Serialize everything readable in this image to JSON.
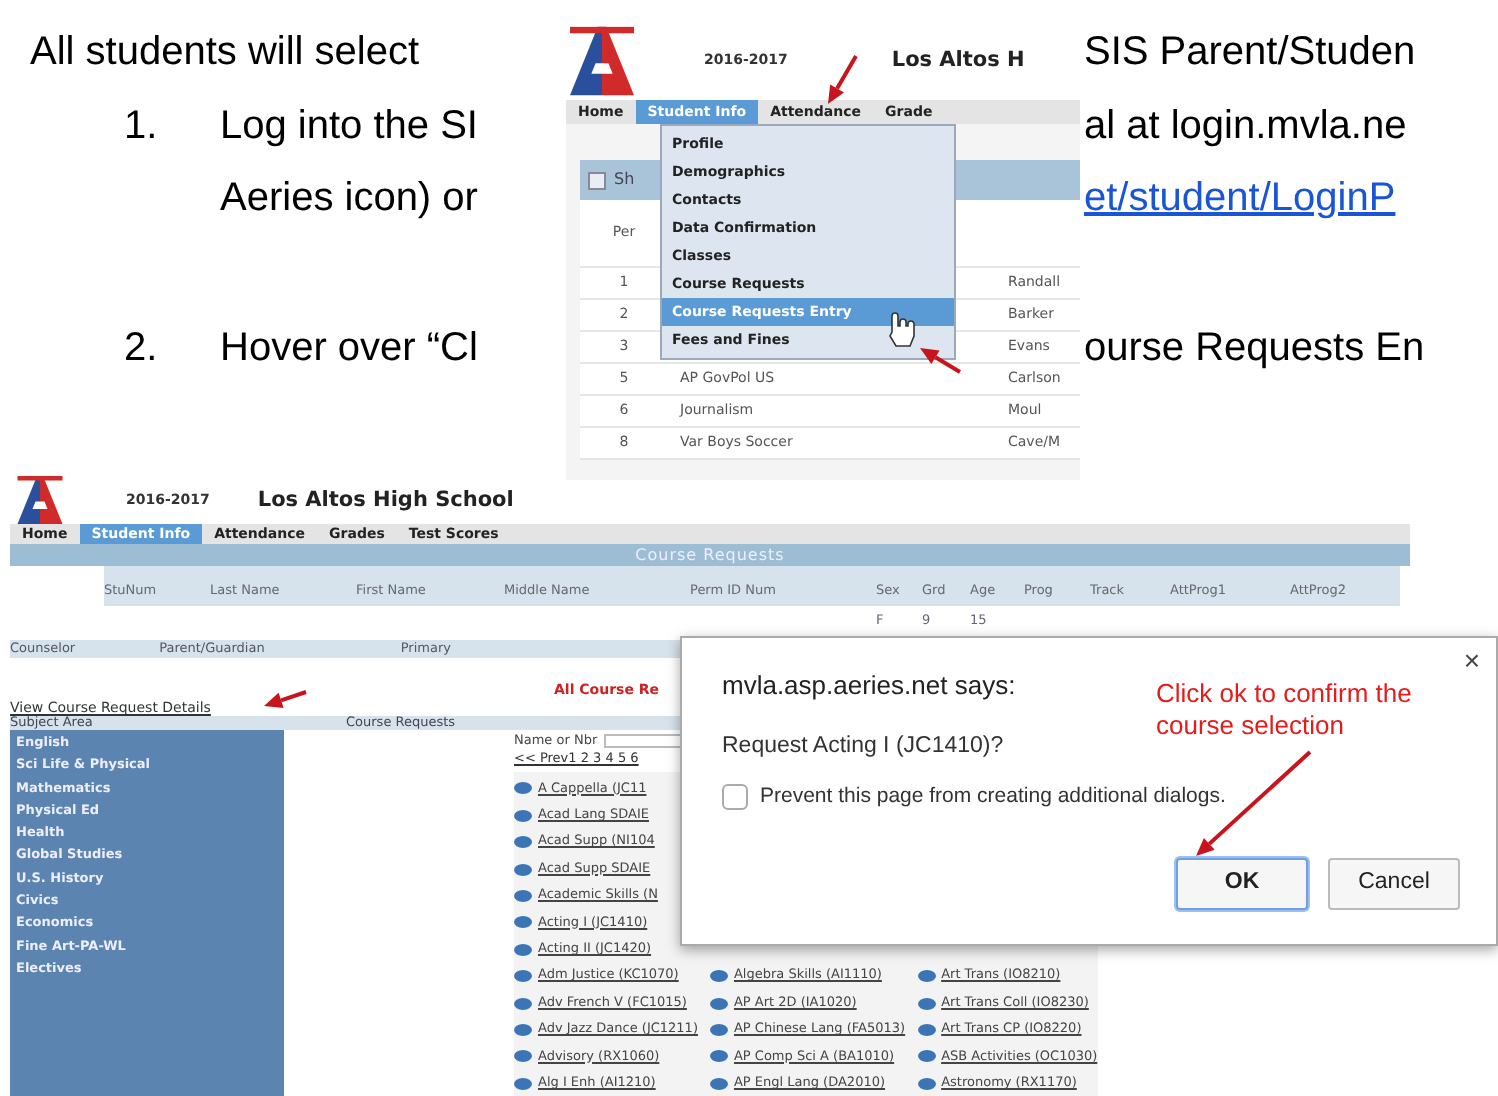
{
  "slide_text": [
    {
      "kind": "text",
      "text": "All students will select"
    },
    {
      "kind": "text",
      "text": "SIS Parent/Studen"
    },
    {
      "kind": "number",
      "text": "1."
    },
    {
      "kind": "text",
      "text": "Log into the SI"
    },
    {
      "kind": "text",
      "text": "al at login.mvla.ne"
    },
    {
      "kind": "text",
      "text": "Aeries icon) or"
    },
    {
      "kind": "link",
      "text": "et/student/LoginP"
    },
    {
      "kind": "number",
      "text": "2."
    },
    {
      "kind": "text",
      "text": "Hover over “Cl"
    },
    {
      "kind": "text",
      "text": "ourse Requests En"
    }
  ],
  "menu_screenshot": {
    "year": "2016-2017",
    "school": "Los Altos H",
    "nav": [
      {
        "label": "Home",
        "selected": false
      },
      {
        "label": "Student Info",
        "selected": true
      },
      {
        "label": "Attendance",
        "selected": false
      },
      {
        "label": "Grade",
        "selected": false
      }
    ],
    "menu": [
      {
        "label": "Profile",
        "selected": false
      },
      {
        "label": "Demographics",
        "selected": false
      },
      {
        "label": "Contacts",
        "selected": false
      },
      {
        "label": "Data Confirmation",
        "selected": false
      },
      {
        "label": "Classes",
        "selected": false
      },
      {
        "label": "Course Requests",
        "selected": false
      },
      {
        "label": "Course Requests Entry",
        "selected": true
      },
      {
        "label": "Fees and Fines",
        "selected": false
      }
    ],
    "panel_title": "Sh",
    "column": "Per",
    "rows": [
      {
        "period": "1",
        "teacher": "Randall"
      },
      {
        "period": "2",
        "teacher": "Barker"
      },
      {
        "period": "3",
        "teacher": "Evans"
      },
      {
        "period": "5",
        "course": "AP GovPol US",
        "teacher": "Carlson"
      },
      {
        "period": "6",
        "course": "Journalism",
        "teacher": "Moul"
      },
      {
        "period": "8",
        "course": "Var Boys Soccer",
        "teacher": "Cave/M"
      }
    ]
  },
  "requests_screenshot": {
    "year": "2016-2017",
    "school": "Los Altos High School",
    "nav": [
      {
        "label": "Home",
        "selected": false
      },
      {
        "label": "Student Info",
        "selected": true
      },
      {
        "label": "Attendance",
        "selected": false
      },
      {
        "label": "Grades",
        "selected": false
      },
      {
        "label": "Test Scores",
        "selected": false
      }
    ],
    "title": "Course Requests",
    "columns": [
      {
        "label": "StuNum"
      },
      {
        "label": "Last Name"
      },
      {
        "label": "First Name"
      },
      {
        "label": "Middle Name"
      },
      {
        "label": "Perm ID Num"
      },
      {
        "label": "Sex",
        "value": "F"
      },
      {
        "label": "Grd",
        "value": "9"
      },
      {
        "label": "Age",
        "value": "15"
      },
      {
        "label": "Prog"
      },
      {
        "label": "Track"
      },
      {
        "label": "AttProg1"
      },
      {
        "label": "AttProg2"
      }
    ],
    "info_labels": [
      "Counselor",
      "Parent/Guardian",
      "Primary"
    ],
    "status": "All Course Re",
    "details_link": "View Course Request Details",
    "list_headers": [
      "Subject Area",
      "Course Requests"
    ],
    "subjects": [
      "English",
      "Sci Life & Physical",
      "Mathematics",
      "Physical Ed",
      "Health",
      "Global Studies",
      "U.S. History",
      "Civics",
      "Economics",
      "Fine Art-PA-WL",
      "Electives"
    ],
    "search": {
      "label": "Name or Nbr"
    },
    "pager": "<< Prev1 2 3 4 5 6",
    "course_columns": [
      [
        "A Cappella (JC11",
        "Acad Lang SDAIE",
        "Acad Supp (NI104",
        "Acad Supp SDAIE",
        "Academic Skills (N",
        "Acting I (JC1410)",
        "Acting II (JC1420)",
        "Adm Justice (KC1070)",
        "Adv French V (FC1015)",
        "Adv Jazz Dance (JC1211)",
        "Advisory (RX1060)",
        "Alg I Enh (AI1210)"
      ],
      [
        "Algebra Skills (AI1110)",
        "AP Art 2D (IA1020)",
        "AP Chinese Lang (FA5013)",
        "AP Comp Sci A (BA1010)",
        "AP Engl Lang (DA2010)"
      ],
      [
        "Art Trans (IO8210)",
        "Art Trans Coll (IO8230)",
        "Art Trans CP (IO8220)",
        "ASB Activities (OC1030)",
        "Astronomy (RX1170)"
      ]
    ]
  },
  "dialog": {
    "origin": "mvla.asp.aeries.net says:",
    "close": "×",
    "message": "Request Acting I (JC1410)?",
    "checkbox": {
      "label": "Prevent this page from creating additional dialogs.",
      "checked": false
    },
    "buttons": [
      {
        "label": "OK",
        "focused": true
      },
      {
        "label": "Cancel",
        "focused": false
      }
    ]
  },
  "annotation": "Click ok to confirm the course selection"
}
